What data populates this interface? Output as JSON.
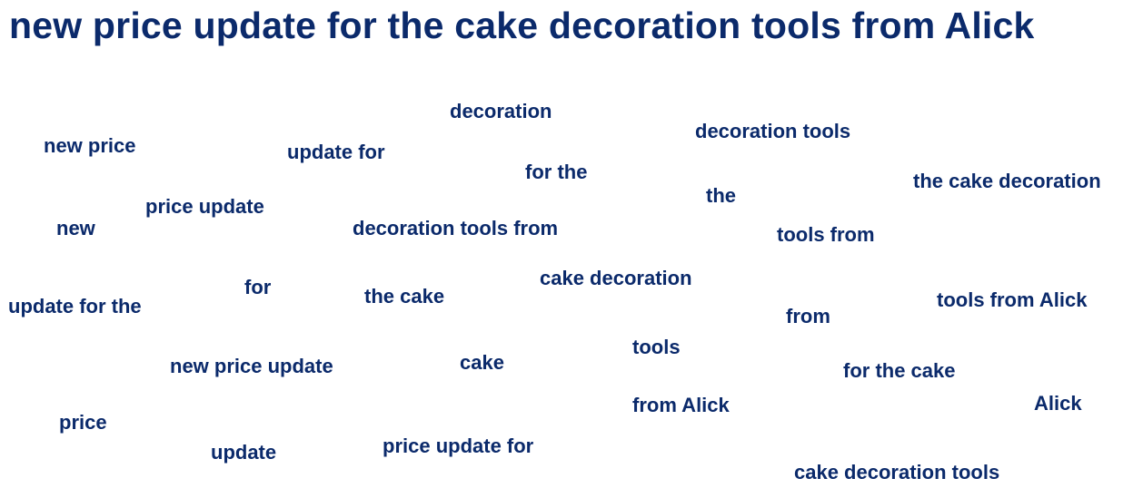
{
  "page": {
    "title": "new price update for the cake decoration tools from Alick",
    "text_color": "#0b2a6b",
    "background_color": "#ffffff"
  },
  "phrases": [
    "decoration",
    "new price",
    "update for",
    "decoration tools",
    "for the",
    "the cake decoration",
    "the",
    "price update",
    "new",
    "decoration tools from",
    "tools from",
    "cake decoration",
    "for",
    "the cake",
    "tools from Alick",
    "update for the",
    "from",
    "tools",
    "cake",
    "new price update",
    "for the cake",
    "from Alick",
    "Alick",
    "price",
    "price update for",
    "update",
    "cake decoration tools"
  ]
}
